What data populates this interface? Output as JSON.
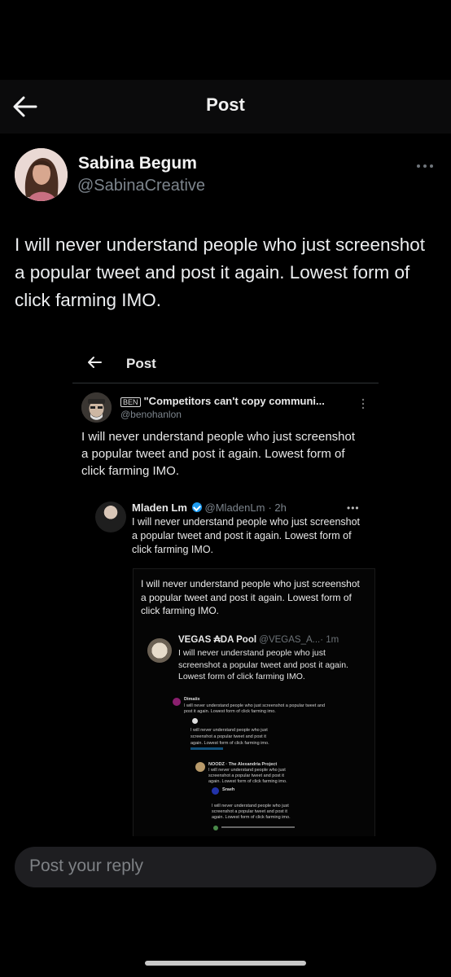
{
  "header": {
    "title": "Post"
  },
  "post": {
    "author_name": "Sabina Begum",
    "author_handle": "@SabinaCreative",
    "text": "I will never understand people who just screenshot a popular tweet and post it again. Lowest form of click farming IMO."
  },
  "embedded": {
    "header_title": "Post",
    "author_badge": "BEN",
    "author_name": "\"Competitors can't copy communi...",
    "author_handle": "@benohanlon",
    "text": "I will never understand people who just screenshot a popular tweet and post it again. Lowest form of click farming IMO.",
    "nested": {
      "author_name": "Mladen Lm",
      "author_handle": "@MladenLm",
      "time": "· 2h",
      "text": "I will never understand people who just screenshot a popular tweet and post it again. Lowest form of click farming IMO.",
      "inner": {
        "text": "I will never understand people who just screenshot a popular tweet and post it again. Lowest form of click farming IMO.",
        "reply_author": "VEGAS ₳DA Pool",
        "reply_handle": "@VEGAS_A...",
        "reply_time": "· 1m",
        "reply_text": "I will never understand people who just screenshot a popular tweet and post it again. Lowest form of click farming IMO.",
        "tiny": {
          "name1": "Dimaiix",
          "text1a": "I will never understand people who just screenshot a popular tweet and",
          "text1b": "post it again. Lowest form of click farming imo.",
          "text2a": "I will never understand people who just",
          "text2b": "screenshot a popular tweet and post it",
          "text2c": "again. Lowest form of click farming imo.",
          "name3": "NOODZ · The Alexandria Project",
          "text3a": "I will never understand people who just",
          "text3b": "screenshot a popular tweet and post it",
          "text3c": "again. Lowest form of click farming imo.",
          "name4": "Sraeh",
          "text4a": "I will never understand people who just",
          "text4b": "screenshot a popular tweet and post it",
          "text4c": "again. Lowest form of click farming imo."
        }
      }
    }
  },
  "reply": {
    "placeholder": "Post your reply"
  },
  "colors": {
    "background": "#000000",
    "accent": "#1d9bf0",
    "muted": "#7c848c"
  },
  "icons": {
    "back": "arrow-left-icon",
    "more": "more-horizontal-icon",
    "verified": "verified-badge-icon"
  }
}
